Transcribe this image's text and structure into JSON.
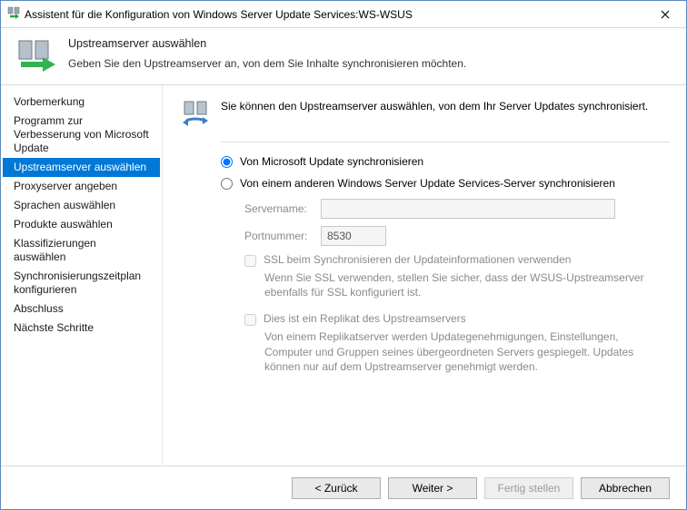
{
  "window": {
    "title": "Assistent für die Konfiguration von Windows Server Update Services:WS-WSUS"
  },
  "header": {
    "title": "Upstreamserver auswählen",
    "subtitle": "Geben Sie den Upstreamserver an, von dem Sie Inhalte synchronisieren möchten."
  },
  "sidebar": {
    "items": [
      "Vorbemerkung",
      "Programm zur Verbesserung von Microsoft Update",
      "Upstreamserver auswählen",
      "Proxyserver angeben",
      "Sprachen auswählen",
      "Produkte auswählen",
      "Klassifizierungen auswählen",
      "Synchronisierungszeitplan konfigurieren",
      "Abschluss",
      "Nächste Schritte"
    ],
    "selected_index": 2
  },
  "content": {
    "intro": "Sie können den Upstreamserver auswählen, von dem Ihr Server Updates synchronisiert.",
    "radio1": "Von Microsoft Update synchronisieren",
    "radio2": "Von einem anderen Windows Server Update Services-Server synchronisieren",
    "servername_label": "Servername:",
    "servername_value": "",
    "port_label": "Portnummer:",
    "port_value": "8530",
    "ssl_label": "SSL beim Synchronisieren der Updateinformationen verwenden",
    "ssl_desc": "Wenn Sie SSL verwenden, stellen Sie sicher, dass der WSUS-Upstreamserver ebenfalls für SSL konfiguriert ist.",
    "replica_label": "Dies ist ein Replikat des Upstreamservers",
    "replica_desc": "Von einem Replikatserver werden Updategenehmigungen, Einstellungen, Computer und Gruppen seines übergeordneten Servers gespiegelt. Updates können nur auf dem Upstreamserver genehmigt werden."
  },
  "footer": {
    "back": "< Zurück",
    "next": "Weiter >",
    "finish": "Fertig stellen",
    "cancel": "Abbrechen"
  }
}
